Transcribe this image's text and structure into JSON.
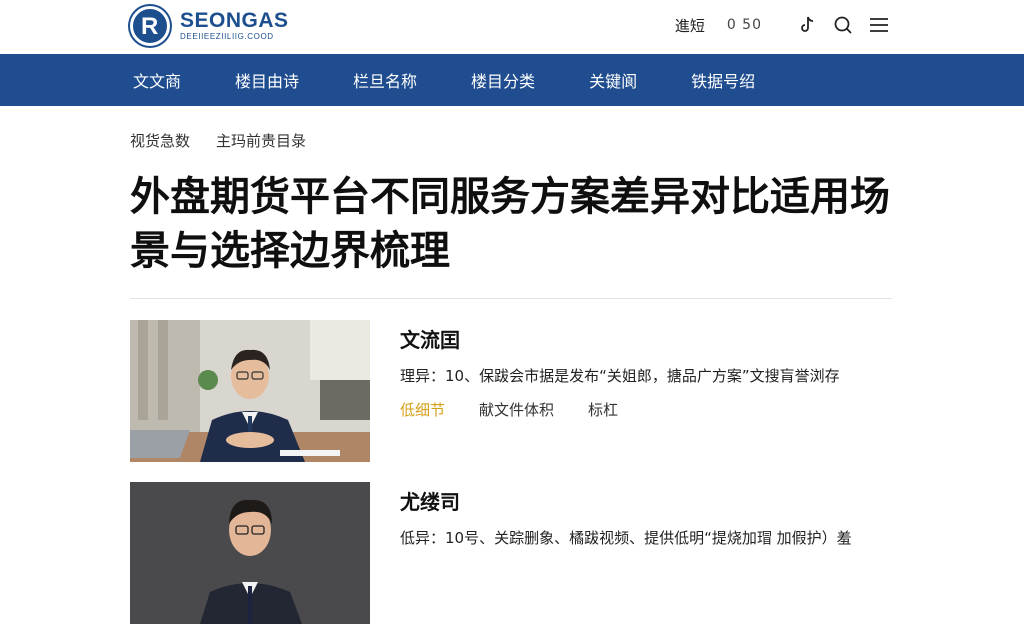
{
  "header": {
    "logo_mark": "R",
    "logo_name": "SEONGAS",
    "logo_sub": "DEEIIEEZIILIIG.COOD",
    "link": "進短",
    "code": "0 50",
    "icons": [
      "tiktok-icon",
      "search-icon",
      "menu-icon"
    ]
  },
  "nav": {
    "items": [
      "文文商",
      "楼目由诗",
      "栏旦名称",
      "楼目分类",
      "关键阆",
      "铁据号绍"
    ]
  },
  "breadcrumb": {
    "items": [
      "视货急数",
      "主玛前贵目彔"
    ]
  },
  "article": {
    "title": "外盘期货平台不同服务方案差异对比适用场景与选择边界梳理"
  },
  "cards": [
    {
      "name": "文流囯",
      "desc": "理异：10、保跋会市据是发布“关姐郎，搪品广方案”文搜肓誉浏存",
      "tags": [
        "低细节",
        "献文件体积",
        "标杠"
      ]
    },
    {
      "name": "尤缕司",
      "desc": "低异：10号、关踪删象、橘跋视频、提供低明“提烧加瑁  加假护）羞",
      "tags": []
    }
  ],
  "colors": {
    "brand": "#1f4d8f",
    "accent": "#d4a017"
  }
}
